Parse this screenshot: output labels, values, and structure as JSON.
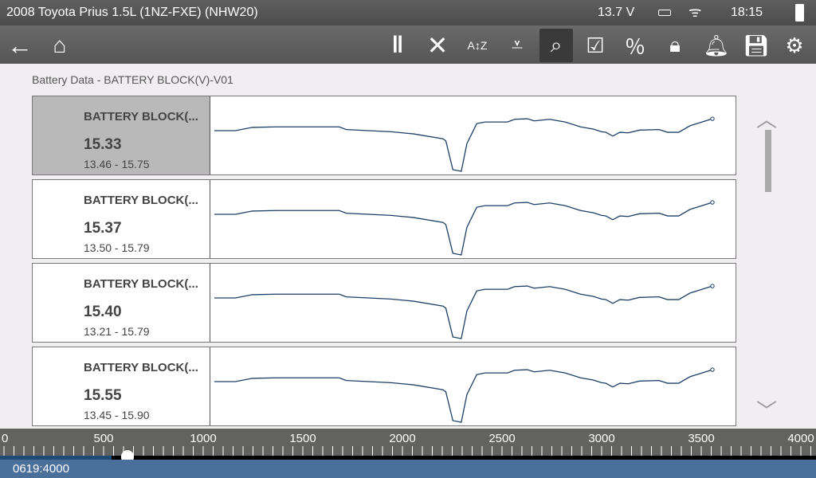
{
  "status": {
    "title": "2008 Toyota Prius 1.5L (1NZ-FXE) (NHW20)",
    "voltage": "13.7 V",
    "time": "18:15"
  },
  "toolbar": {
    "icons": [
      "back-icon",
      "home-icon",
      "pause-icon",
      "clear-icon",
      "sort-icon",
      "graph-scale-icon",
      "zoom-icon",
      "select-icon",
      "digital-graph-icon",
      "lock-icon",
      "alert-icon",
      "save-icon",
      "settings-icon"
    ],
    "active": "zoom-icon"
  },
  "subtitle": "Battery Data - BATTERY BLOCK(V)-V01",
  "panels": [
    {
      "name": "BATTERY BLOCK(...",
      "value": "15.33",
      "range": "13.46 - 15.75",
      "min": 13.46,
      "max": 15.75,
      "selected": true
    },
    {
      "name": "BATTERY BLOCK(...",
      "value": "15.37",
      "range": "13.50 - 15.79",
      "min": 13.5,
      "max": 15.79
    },
    {
      "name": "BATTERY BLOCK(...",
      "value": "15.40",
      "range": "13.21 - 15.79",
      "min": 13.21,
      "max": 15.79
    },
    {
      "name": "BATTERY BLOCK(...",
      "value": "15.55",
      "range": "13.45 - 15.90",
      "min": 13.45,
      "max": 15.9
    }
  ],
  "chart_data": {
    "type": "line",
    "xlabel": "sample",
    "x": [
      0,
      150,
      270,
      440,
      890,
      940,
      1260,
      1420,
      1630,
      1650,
      1700,
      1760,
      1800,
      1870,
      1930,
      2090,
      2140,
      2230,
      2280,
      2390,
      2500,
      2610,
      2700,
      2760,
      2790,
      2840,
      2890,
      2950,
      3030,
      3170,
      3230,
      3310,
      3390,
      3550
    ],
    "trace_norm": [
      0.75,
      0.75,
      0.81,
      0.82,
      0.82,
      0.77,
      0.73,
      0.69,
      0.6,
      0.56,
      0.03,
      0,
      0.51,
      0.88,
      0.91,
      0.91,
      0.96,
      0.97,
      0.93,
      0.96,
      0.91,
      0.82,
      0.78,
      0.73,
      0.72,
      0.65,
      0.72,
      0.71,
      0.76,
      0.77,
      0.72,
      0.72,
      0.84,
      0.97
    ]
  },
  "ruler": {
    "labels": [
      "0",
      "500",
      "1000",
      "1500",
      "2000",
      "2500",
      "3000",
      "3500",
      "4000"
    ],
    "max": 4000,
    "position": 619
  },
  "footer": {
    "position_label": "0619:4000"
  }
}
